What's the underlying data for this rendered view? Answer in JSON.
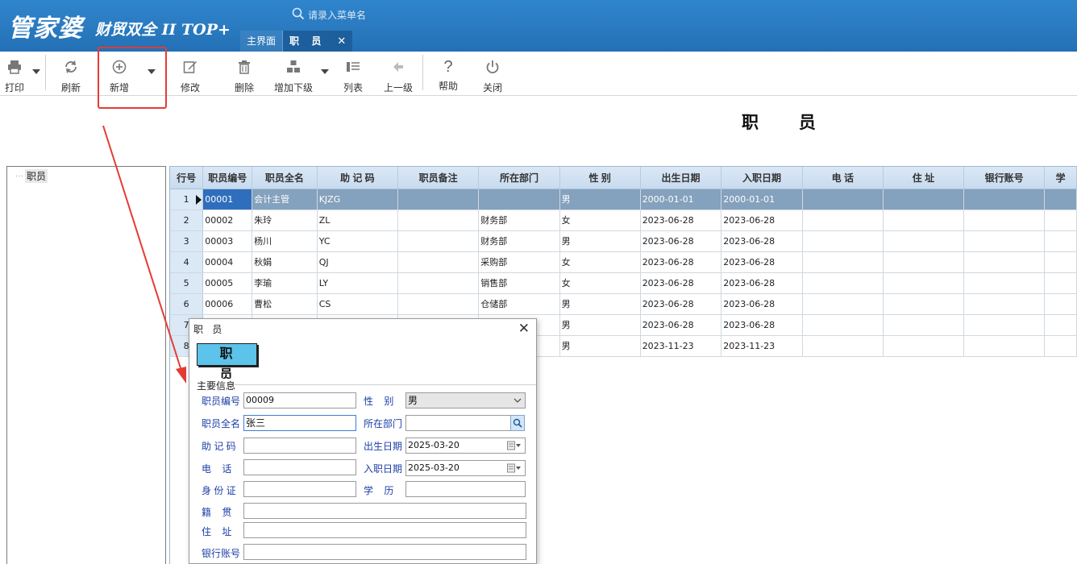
{
  "header": {
    "brand": "管家婆",
    "brand_sub": "财贸双全 II TOP+",
    "search_placeholder": "请录入菜单名",
    "tabs": [
      {
        "label": "主界面"
      },
      {
        "label": "职 员",
        "close": "✕"
      }
    ]
  },
  "toolbar": {
    "print": "打印",
    "refresh": "刷新",
    "add": "新增",
    "edit": "修改",
    "delete": "删除",
    "add_child": "增加下级",
    "list": "列表",
    "up_level": "上一级",
    "help": "帮助",
    "close": "关闭"
  },
  "page_title": "职 员",
  "tree": {
    "root": "职员"
  },
  "grid": {
    "columns": [
      "行号",
      "职员编号",
      "职员全名",
      "助 记 码",
      "职员备注",
      "所在部门",
      "性  别",
      "出生日期",
      "入职日期",
      "电  话",
      "住  址",
      "银行账号",
      "学"
    ],
    "rows": [
      {
        "n": "1",
        "code": "00001",
        "name": "会计主管",
        "mnemonic": "KJZG",
        "note": "",
        "dept": "",
        "gender": "男",
        "birth": "2000-01-01",
        "hire": "2000-01-01"
      },
      {
        "n": "2",
        "code": "00002",
        "name": "朱玲",
        "mnemonic": "ZL",
        "note": "",
        "dept": "财务部",
        "gender": "女",
        "birth": "2023-06-28",
        "hire": "2023-06-28"
      },
      {
        "n": "3",
        "code": "00003",
        "name": "杨川",
        "mnemonic": "YC",
        "note": "",
        "dept": "财务部",
        "gender": "男",
        "birth": "2023-06-28",
        "hire": "2023-06-28"
      },
      {
        "n": "4",
        "code": "00004",
        "name": "秋娟",
        "mnemonic": "QJ",
        "note": "",
        "dept": "采购部",
        "gender": "女",
        "birth": "2023-06-28",
        "hire": "2023-06-28"
      },
      {
        "n": "5",
        "code": "00005",
        "name": "李瑜",
        "mnemonic": "LY",
        "note": "",
        "dept": "销售部",
        "gender": "女",
        "birth": "2023-06-28",
        "hire": "2023-06-28"
      },
      {
        "n": "6",
        "code": "00006",
        "name": "曹松",
        "mnemonic": "CS",
        "note": "",
        "dept": "仓储部",
        "gender": "男",
        "birth": "2023-06-28",
        "hire": "2023-06-28"
      },
      {
        "n": "7",
        "code": "",
        "name": "",
        "mnemonic": "",
        "note": "",
        "dept": "",
        "gender": "男",
        "birth": "2023-06-28",
        "hire": "2023-06-28"
      },
      {
        "n": "8",
        "code": "",
        "name": "",
        "mnemonic": "",
        "note": "",
        "dept": "",
        "gender": "男",
        "birth": "2023-11-23",
        "hire": "2023-11-23"
      }
    ]
  },
  "dialog": {
    "title": "职 员",
    "banner": "职 员",
    "group": "主要信息",
    "labels": {
      "code": "职员编号",
      "name": "职员全名",
      "mnemonic": "助 记 码",
      "phone": "电    话",
      "id_card": "身 份 证",
      "native": "籍    贯",
      "address": "住    址",
      "bank": "银行账号",
      "gender": "性    别",
      "dept": "所在部门",
      "birth": "出生日期",
      "hire": "入职日期",
      "education": "学    历"
    },
    "values": {
      "code": "00009",
      "name": "张三",
      "gender": "男",
      "birth": "2025-03-20",
      "hire": "2025-03-20"
    }
  },
  "colors": {
    "header": "#2a7ac0",
    "highlight": "#e53b35",
    "selected_row": "#84a1bd",
    "label_blue": "#1c3fa8"
  }
}
